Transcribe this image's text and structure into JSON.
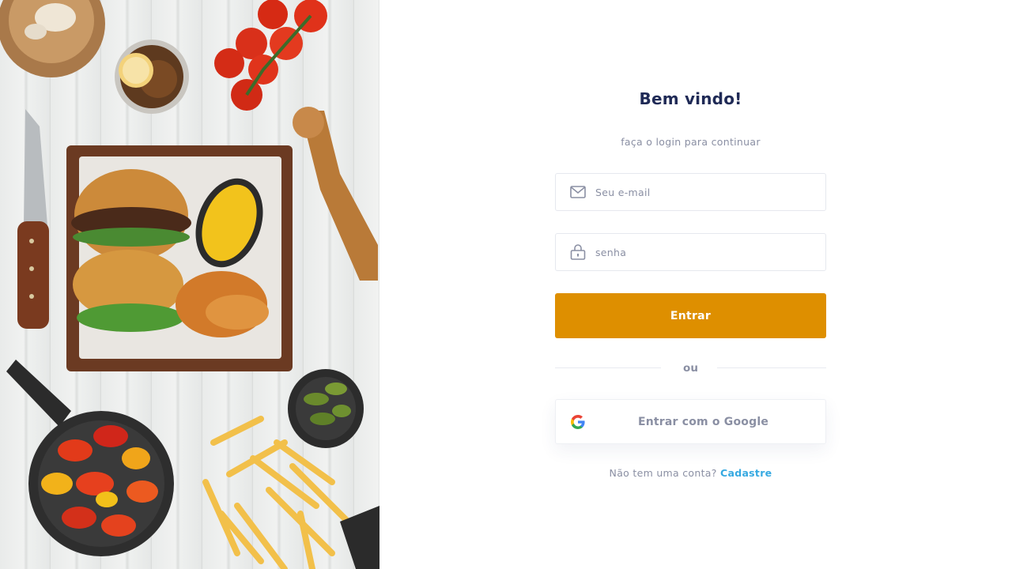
{
  "hero": {
    "image": "food-flatlay-burger-fries-peppers"
  },
  "login": {
    "title": "Bem vindo!",
    "subtitle": "faça o login para continuar",
    "email": {
      "placeholder": "Seu e-mail",
      "value": "",
      "icon": "mail-icon"
    },
    "password": {
      "placeholder": "senha",
      "value": "",
      "icon": "lock-icon"
    },
    "submit_label": "Entrar",
    "divider_label": "ou",
    "google": {
      "label": "Entrar com o Google",
      "icon": "google-icon"
    },
    "signup": {
      "prompt": "Não tem uma conta?",
      "link_label": "Cadastre"
    }
  },
  "colors": {
    "title": "#1f2a56",
    "muted": "#8a8fa3",
    "primary_button": "#de8f00",
    "link": "#36a9e1",
    "border": "#e6e8ee"
  }
}
